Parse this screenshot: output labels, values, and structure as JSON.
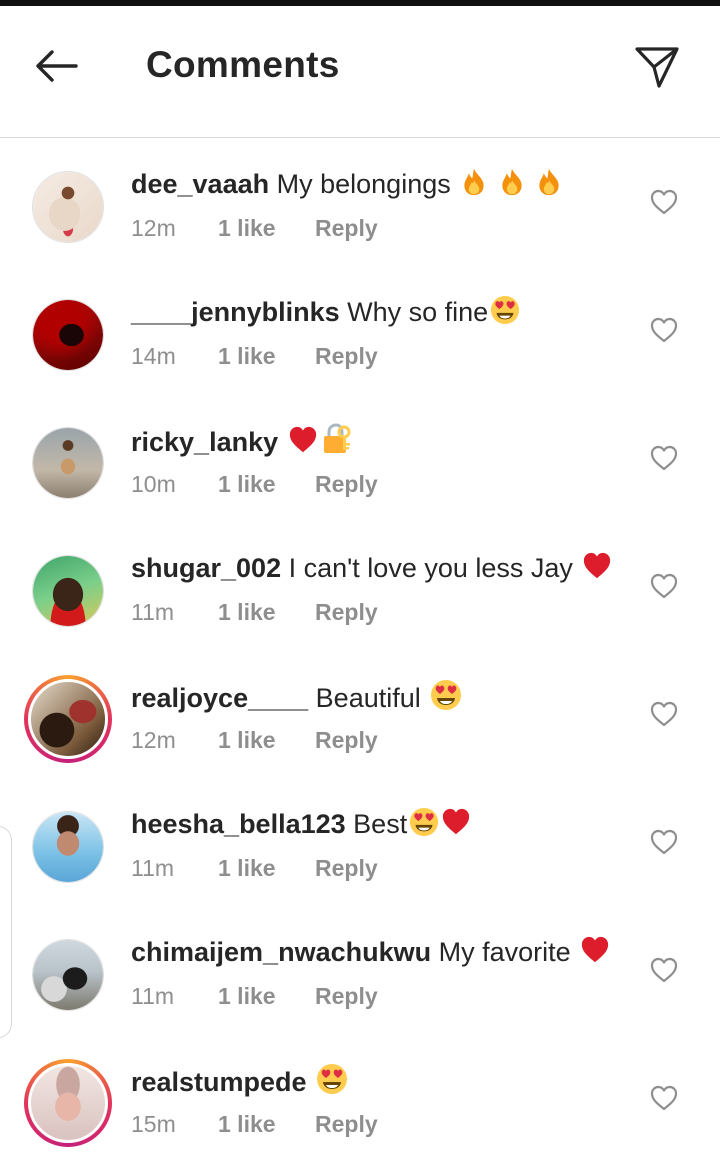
{
  "header": {
    "title": "Comments"
  },
  "comments": [
    {
      "username": "dee_vaaah",
      "text": "My belongings",
      "time": "12m",
      "likes": "1 like",
      "reply": "Reply"
    },
    {
      "username": "____jennyblinks",
      "text": "Why so fine",
      "time": "14m",
      "likes": "1 like",
      "reply": "Reply"
    },
    {
      "username": "ricky_lanky",
      "text": "",
      "time": "10m",
      "likes": "1 like",
      "reply": "Reply"
    },
    {
      "username": "shugar_002",
      "text": "I can't love you less Jay",
      "time": "11m",
      "likes": "1 like",
      "reply": "Reply"
    },
    {
      "username": "realjoyce____",
      "text": "Beautiful",
      "time": "12m",
      "likes": "1 like",
      "reply": "Reply"
    },
    {
      "username": "heesha_bella123",
      "text": "Best",
      "time": "11m",
      "likes": "1 like",
      "reply": "Reply"
    },
    {
      "username": "chimaijem_nwachukwu",
      "text": "My favorite",
      "time": "11m",
      "likes": "1 like",
      "reply": "Reply"
    },
    {
      "username": "realstumpede",
      "text": "",
      "time": "15m",
      "likes": "1 like",
      "reply": "Reply"
    }
  ],
  "colors": {
    "text": "#262626",
    "meta": "#8e8e8e",
    "divider": "#dbdbdb",
    "heart_red": "#dd1c2c"
  },
  "icons": [
    "back-arrow-icon",
    "send-icon",
    "heart-outline-icon",
    "fire-emoji",
    "heart-eyes-emoji",
    "red-heart-emoji",
    "lock-key-emoji"
  ]
}
